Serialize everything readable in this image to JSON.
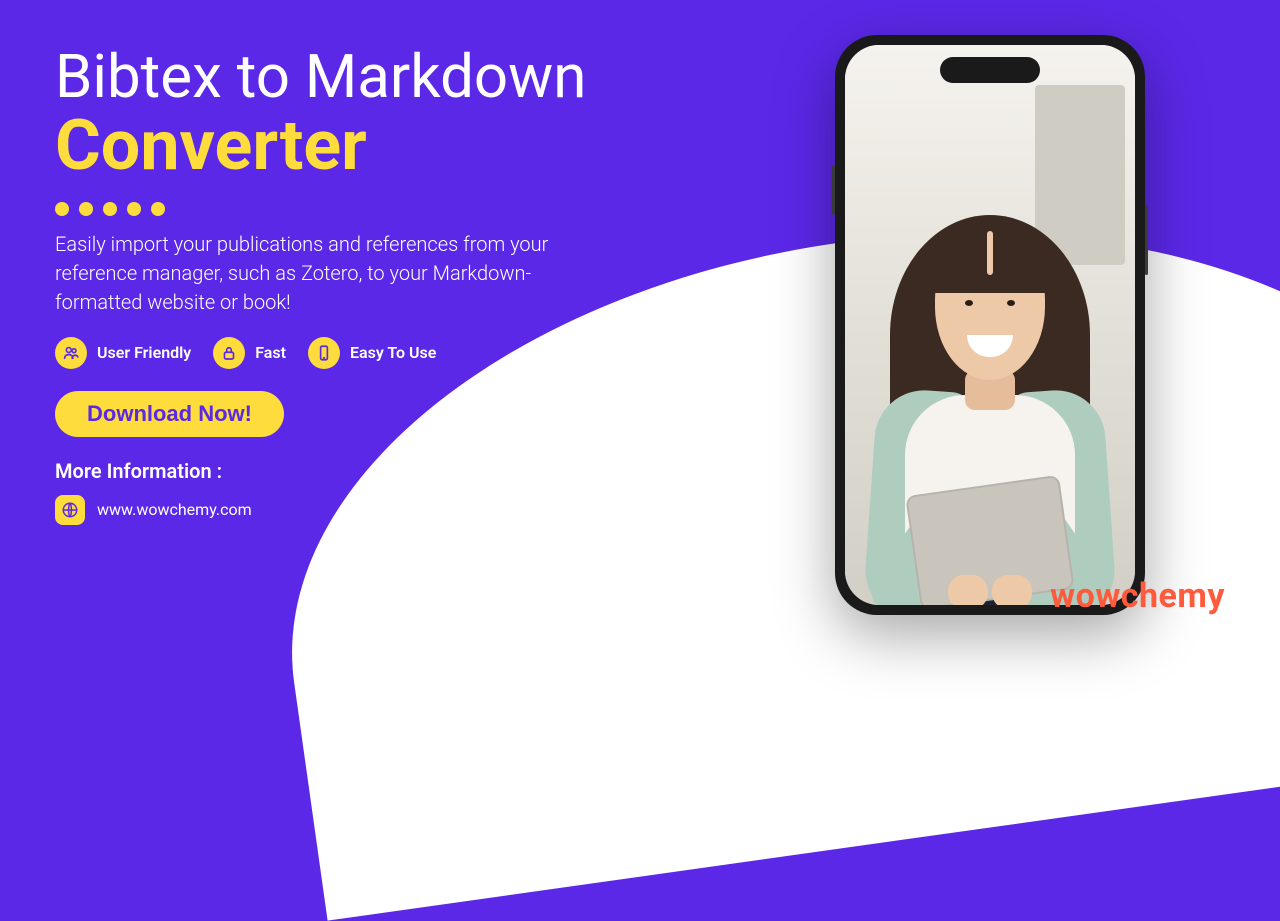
{
  "title": {
    "line1": "Bibtex to Markdown",
    "line2": "Converter"
  },
  "description": "Easily import your publications and references from your reference manager, such as Zotero, to your Markdown-formatted website or book!",
  "features": [
    {
      "label": "User Friendly",
      "icon": "users-icon"
    },
    {
      "label": "Fast",
      "icon": "lock-icon"
    },
    {
      "label": "Easy To Use",
      "icon": "phone-icon"
    }
  ],
  "cta_label": "Download Now!",
  "more_info": {
    "title": "More Information :",
    "url": "www.wowchemy.com"
  },
  "brand": "wowchemy",
  "colors": {
    "bg": "#5b28e8",
    "accent": "#fddc3b",
    "brand": "#ff5a3c"
  }
}
